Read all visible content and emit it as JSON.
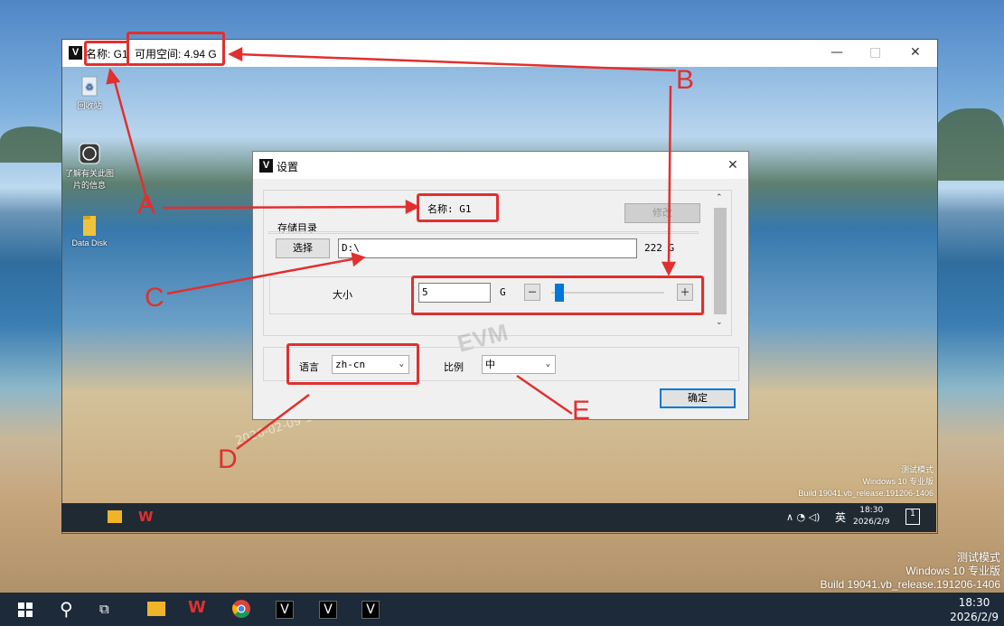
{
  "outer_window": {
    "title_name": "名称: G1",
    "title_space": "可用空间: 4.94 G",
    "minimize_label": "—",
    "maximize_label": "□",
    "close_label": "✕"
  },
  "desktop_icons": [
    {
      "label": "回收站",
      "icon": "recycle-bin-icon"
    },
    {
      "label": "了解有关此图片的信息",
      "icon": "info-icon"
    },
    {
      "label": "Data Disk",
      "icon": "folder-icon"
    }
  ],
  "dialog": {
    "title": "设置",
    "close_label": "✕",
    "name_label": "名称: G1",
    "modify_button": "修改",
    "storage_label": "存储目录",
    "choose_button": "选择",
    "path_value": "D:\\",
    "disk_free": "222 G",
    "size_label": "大小",
    "size_value": "5",
    "size_unit": "G",
    "minus_label": "－",
    "plus_label": "＋",
    "size_slider_fraction": 0.03,
    "language_label": "语言",
    "language_value": "zh-cn",
    "ratio_label": "比例",
    "ratio_value": "中",
    "ok_button": "确定",
    "watermark": "EVM"
  },
  "annotations": {
    "A": "A",
    "B": "B",
    "C": "C",
    "D": "D",
    "E": "E",
    "color": "#e0302f"
  },
  "inner_overlay_text": "2026-02-09 1",
  "inner_watermark": {
    "line1": "测试模式",
    "line2": "Windows 10 专业版",
    "line3": "Build 19041.vb_release.191206-1406"
  },
  "inner_taskbar": {
    "time": "18:30",
    "date": "2026/2/9",
    "ime": "英",
    "notif": "1"
  },
  "outer_watermark": {
    "line1": "测试模式",
    "line2": "Windows 10 专业版",
    "line3": "Build 19041.vb_release.191206-1406"
  },
  "taskbar": {
    "time": "18:30",
    "date": "2026/2/9",
    "v_label": "V"
  }
}
